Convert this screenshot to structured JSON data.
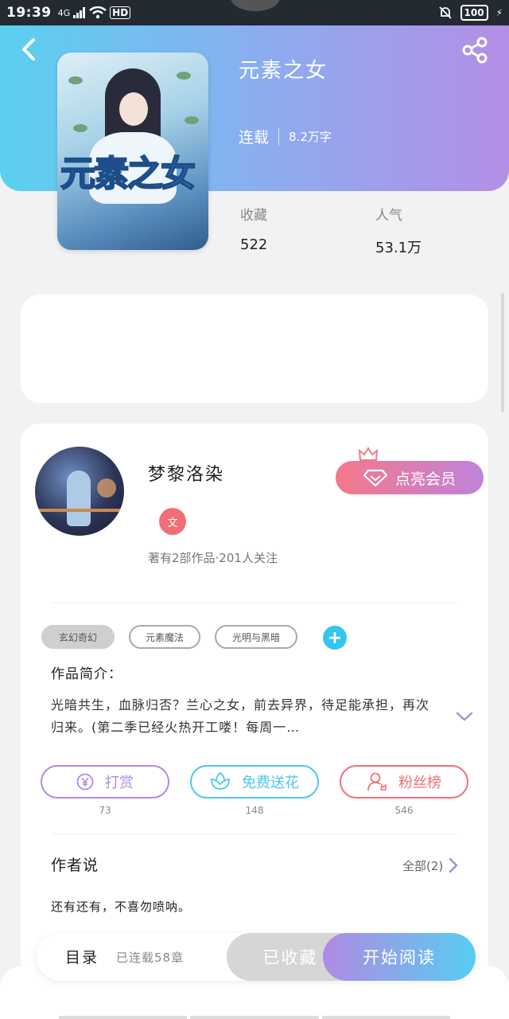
{
  "status_bar": {
    "time": "19:39",
    "network": "4G",
    "hd": "HD",
    "battery": "100"
  },
  "book": {
    "title": "元素之女",
    "status": "连载",
    "word_count": "8.2万字",
    "cover_title": "元素之女",
    "stats": [
      {
        "label": "收藏",
        "value": "522"
      },
      {
        "label": "人气",
        "value": "53.1万"
      }
    ]
  },
  "author": {
    "name": "梦黎洛染",
    "badge": "文",
    "stats": "著有2部作品·201人关注",
    "vip_button": "点亮会员"
  },
  "tags": [
    {
      "label": "玄幻奇幻",
      "filled": true
    },
    {
      "label": "元素魔法",
      "filled": false
    },
    {
      "label": "光明与黑暗",
      "filled": false
    }
  ],
  "intro": {
    "title": "作品简介：",
    "text": "光暗共生，血脉归否？兰心之女，前去异界，待足能承担，再次归来。(第二季已经火热开工喽！每周一…"
  },
  "actions": [
    {
      "label": "打赏",
      "count": "73",
      "color": "#b08ae4",
      "icon": "yen-coin-icon"
    },
    {
      "label": "免费送花",
      "count": "148",
      "color": "#4cc8ec",
      "icon": "flower-icon"
    },
    {
      "label": "粉丝榜",
      "count": "546",
      "color": "#ef6f78",
      "icon": "fan-user-icon"
    }
  ],
  "author_says": {
    "title": "作者说",
    "all_label": "全部(2)",
    "text": "还有还有，不喜勿喷呐。"
  },
  "bottom_bar": {
    "toc": "目录",
    "chapters": "已连载58章",
    "favorited": "已收藏",
    "start_reading": "开始阅读"
  },
  "colors": {
    "header_gradient_start": "#5ad0f0",
    "header_gradient_end": "#b48ee6",
    "vip_gradient_start": "#f57889",
    "vip_gradient_end": "#c083dc",
    "accent_blue": "#34c6ef"
  }
}
